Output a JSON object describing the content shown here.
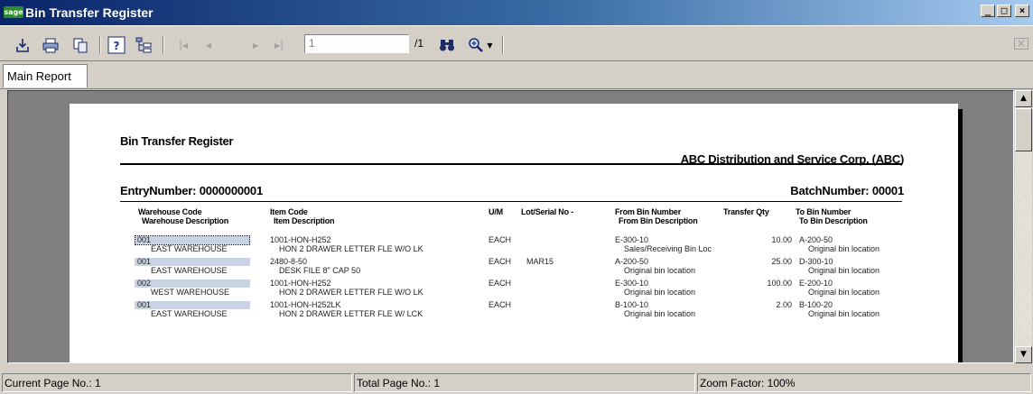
{
  "window": {
    "title": "Bin Transfer Register",
    "logo_text": "sage",
    "minimize": "_",
    "maximize": "□",
    "close": "×"
  },
  "toolbar": {
    "page_input": "1",
    "page_total": "/1",
    "close_glyph": "×"
  },
  "tabs": [
    {
      "label": "Main Report"
    }
  ],
  "report": {
    "title": "Bin Transfer Register",
    "company": "ABC Distribution and Service Corp. (ABC)",
    "entry_label": "EntryNumber: 0000000001",
    "batch_label": "BatchNumber: 00001",
    "headers": {
      "warehouse_code": "Warehouse Code",
      "warehouse_desc": "Warehouse Description",
      "item_code": "Item Code",
      "item_desc": "Item Description",
      "um": "U/M",
      "lot": "Lot/Serial No -",
      "from_bin": "From Bin Number",
      "from_desc": "From Bin Description",
      "qty": "Transfer Qty",
      "to_bin": "To Bin Number",
      "to_desc": "To Bin Description"
    },
    "rows": [
      {
        "wh_code": "001",
        "wh_desc": "EAST WAREHOUSE",
        "item_code": "1001-HON-H252",
        "item_desc": "HON 2 DRAWER LETTER FLE W/O LK",
        "um": "EACH",
        "lot": "",
        "from_bin": "E-300-10",
        "from_desc": "Sales/Receiving Bin Loc",
        "qty": "10.00",
        "to_bin": "A-200-50",
        "to_desc": "Original bin location"
      },
      {
        "wh_code": "001",
        "wh_desc": "EAST WAREHOUSE",
        "item_code": "2480-8-50",
        "item_desc": "DESK FILE 8\" CAP 50",
        "um": "EACH",
        "lot": "MAR15",
        "from_bin": "A-200-50",
        "from_desc": "Original bin location",
        "qty": "25.00",
        "to_bin": "D-300-10",
        "to_desc": "Original bin location"
      },
      {
        "wh_code": "002",
        "wh_desc": "WEST WAREHOUSE",
        "item_code": "1001-HON-H252",
        "item_desc": "HON 2 DRAWER LETTER FLE W/O LK",
        "um": "EACH",
        "lot": "",
        "from_bin": "E-300-10",
        "from_desc": "Original bin location",
        "qty": "100.00",
        "to_bin": "E-200-10",
        "to_desc": "Original bin location"
      },
      {
        "wh_code": "001",
        "wh_desc": "EAST WAREHOUSE",
        "item_code": "1001-HON-H252LK",
        "item_desc": "HON 2 DRAWER LETTER FLE W/ LCK",
        "um": "EACH",
        "lot": "",
        "from_bin": "B-100-10",
        "from_desc": "Original bin location",
        "qty": "2.00",
        "to_bin": "B-100-20",
        "to_desc": "Original bin location"
      }
    ]
  },
  "status": {
    "current_page": "Current Page No.: 1",
    "total_page": "Total Page No.: 1",
    "zoom": "Zoom Factor: 100%"
  }
}
